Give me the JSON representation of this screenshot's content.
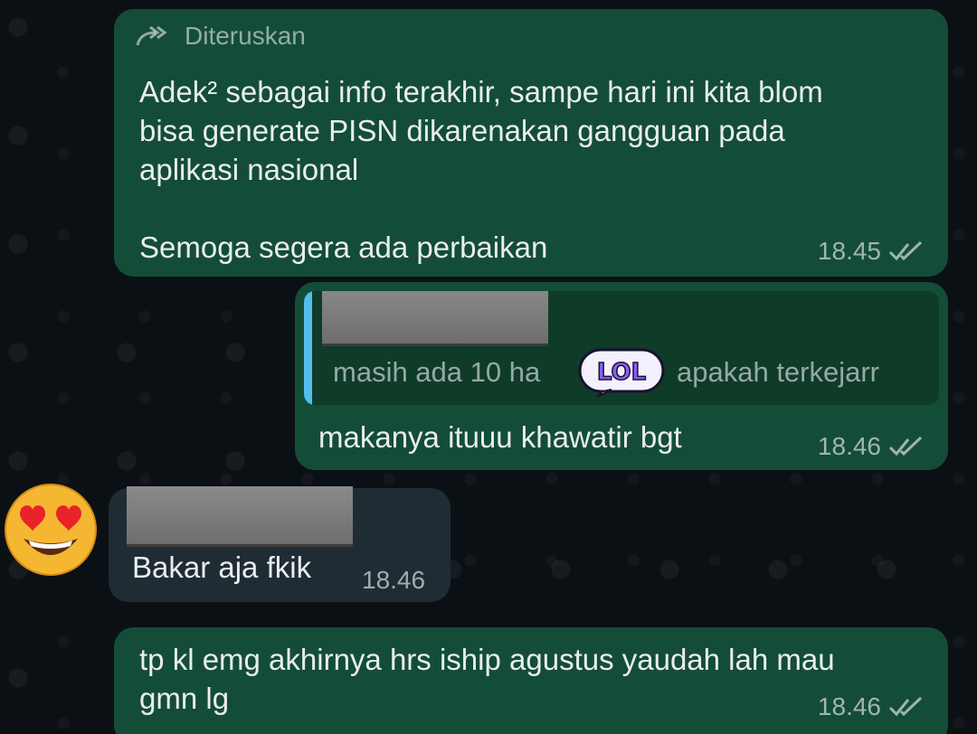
{
  "messages": [
    {
      "forwarded_label": "Diteruskan",
      "text": "Adek² sebagai info terakhir, sampe hari ini kita blom\nbisa generate PISN dikarenakan gangguan pada\naplikasi nasional\n\nSemoga segera ada perbaikan",
      "time": "18.45",
      "status": "read"
    },
    {
      "quote_text": "masih ada 10 ha",
      "quote_sticker": "LOL",
      "quote_text_after": "apakah terkejarr",
      "text": "makanya ituuu khawatir bgt",
      "time": "18.46",
      "status": "read"
    },
    {
      "text": "Bakar aja fkik",
      "time": "18.46",
      "sender_avatar": "heart-eyes-emoji"
    },
    {
      "text": "tp kl emg akhirnya hrs iship agustus yaudah lah mau\ngmn lg",
      "time": "18.46",
      "status": "read"
    }
  ],
  "colors": {
    "outgoing_bubble": "#144d37",
    "incoming_bubble": "#202c33",
    "quote_accent": "#53bdeb",
    "background": "#0b1014"
  }
}
